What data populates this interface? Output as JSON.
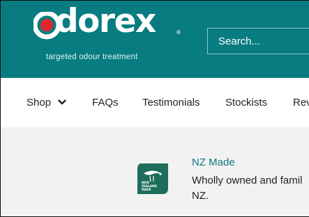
{
  "header": {
    "logo": {
      "name": "Odorex",
      "name_suffix": "dorex",
      "registered": "®",
      "tagline": "targeted odour treatment"
    },
    "search": {
      "placeholder": "Search..."
    }
  },
  "nav": {
    "items": [
      {
        "label": "Shop",
        "has_dropdown": true
      },
      {
        "label": "FAQs"
      },
      {
        "label": "Testimonials"
      },
      {
        "label": "Stockists"
      },
      {
        "label": "Rev"
      }
    ]
  },
  "feature": {
    "title": "NZ Made",
    "body_line1": "Wholly owned and famil",
    "body_line2": "NZ.",
    "badge_text": [
      "NEW",
      "ZEALAND",
      "MADE"
    ]
  },
  "colors": {
    "header_bg": "#087c80",
    "accent_red": "#e0262f",
    "link_teal": "#0c7a80",
    "badge_green": "#1d6d5a",
    "content_bg": "#f2f2f2"
  }
}
